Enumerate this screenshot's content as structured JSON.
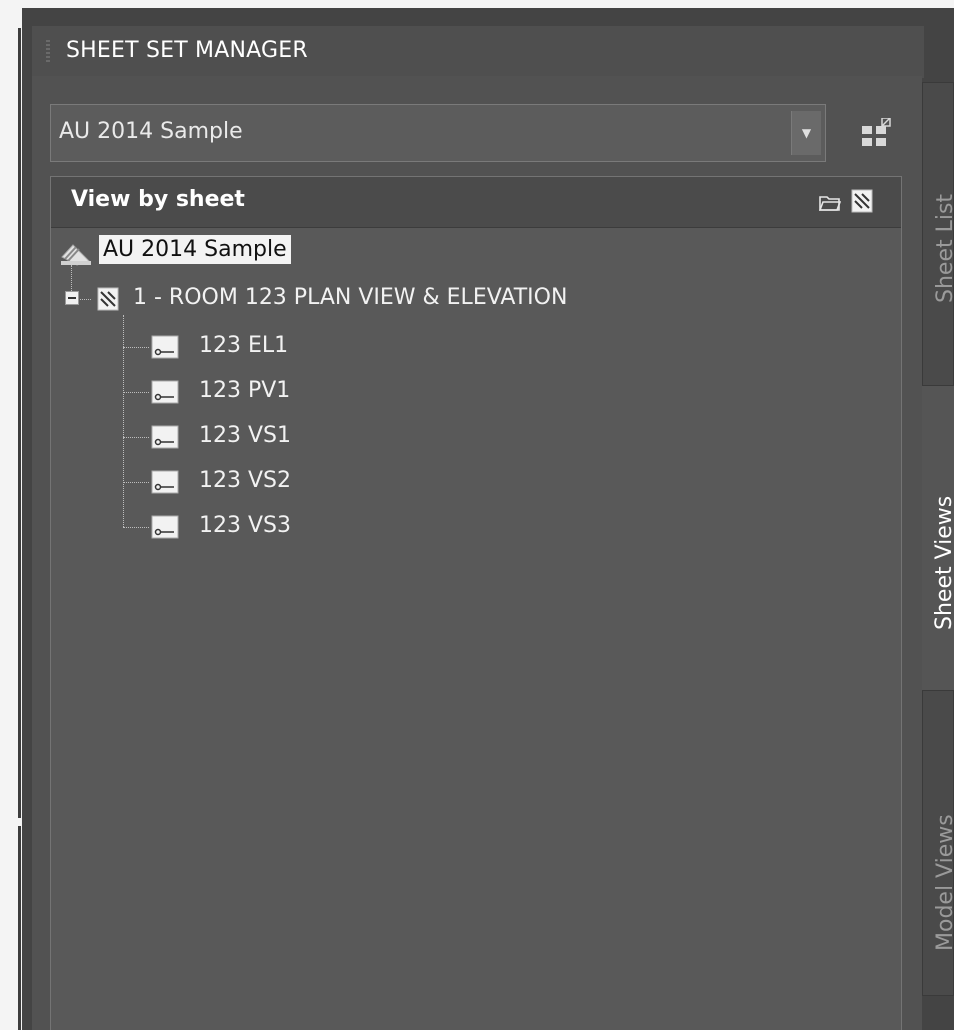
{
  "palette": {
    "workspace": "#f4f4f4",
    "frame": "#444444",
    "panel": "#525252",
    "tree_bg": "#595959",
    "text": "#f2f2f2",
    "selection_bg": "#f3f3f3",
    "selection_text": "#111111"
  },
  "header": {
    "title": "SHEET SET MANAGER"
  },
  "sheet_set_selector": {
    "value": "AU 2014 Sample"
  },
  "tree_panel": {
    "view_label": "View by sheet",
    "header_icons": [
      "folder-icon",
      "sheet-icon"
    ]
  },
  "tree": {
    "root": {
      "label": "AU 2014 Sample",
      "icon": "sheet-set-icon"
    },
    "sheet": {
      "label": "1 - ROOM 123 PLAN VIEW & ELEVATION",
      "icon": "sheet-icon"
    },
    "views": [
      {
        "label": "123 EL1",
        "icon": "view-icon"
      },
      {
        "label": "123 PV1",
        "icon": "view-icon"
      },
      {
        "label": "123 VS1",
        "icon": "view-icon"
      },
      {
        "label": "123 VS2",
        "icon": "view-icon"
      },
      {
        "label": "123 VS3",
        "icon": "view-icon"
      }
    ]
  },
  "side_tabs": [
    {
      "label": "Sheet List",
      "active": false
    },
    {
      "label": "Sheet Views",
      "active": true
    },
    {
      "label": "Model Views",
      "active": false
    }
  ]
}
